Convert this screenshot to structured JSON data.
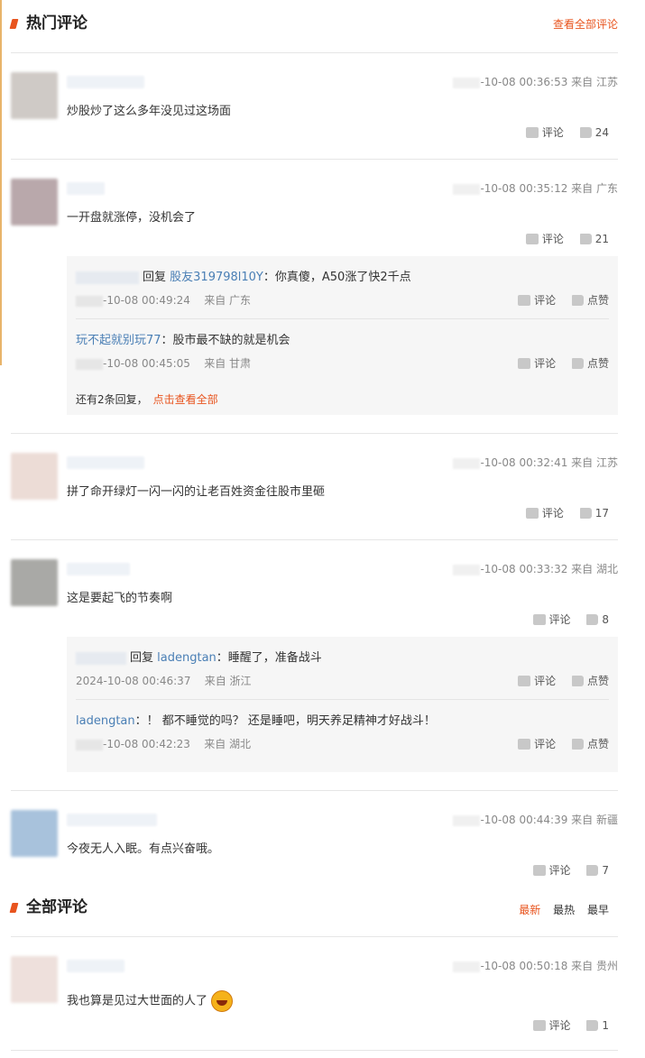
{
  "hot": {
    "title": "热门评论",
    "view_all": "查看全部评论"
  },
  "all": {
    "title": "全部评论",
    "sort": [
      "最新",
      "最热",
      "最早"
    ]
  },
  "action_labels": {
    "comment": "评论",
    "like": "点赞"
  },
  "hot_comments": [
    {
      "time": "-10-08 00:36:53 来自 江苏",
      "text": "炒股炒了这么多年没见过这场面",
      "likes": "24"
    },
    {
      "time": "-10-08 00:35:12 来自 广东",
      "text": "一开盘就涨停，没机会了",
      "likes": "21",
      "replies": [
        {
          "prefix": "回复",
          "target": "股友319798l10Y",
          "content": "：你真傻，A50涨了快2千点",
          "date": "-10-08 00:49:24",
          "loc": "来自 广东"
        },
        {
          "name": "玩不起就别玩77",
          "content": "：股市最不缺的就是机会",
          "date": "-10-08 00:45:05",
          "loc": "来自 甘肃"
        }
      ],
      "more_text": "还有2条回复，",
      "more_link": "点击查看全部"
    },
    {
      "time": "-10-08 00:32:41 来自 江苏",
      "text": "拼了命开绿灯一闪一闪的让老百姓资金往股市里砸",
      "likes": "17"
    },
    {
      "time": "-10-08 00:33:32 来自 湖北",
      "text": "这是要起飞的节奏啊",
      "likes": "8",
      "replies": [
        {
          "prefix": "回复",
          "target": "ladengtan",
          "content": "：睡醒了，准备战斗",
          "date": "2024-10-08 00:46:37",
          "loc": "来自 浙江"
        },
        {
          "name": "ladengtan",
          "content": "：！ 都不睡觉的吗？ 还是睡吧，明天养足精神才好战斗！",
          "date": "-10-08 00:42:23",
          "loc": "来自 湖北"
        }
      ]
    },
    {
      "time": "-10-08 00:44:39 来自 新疆",
      "text": "今夜无人入眠。有点兴奋哦。",
      "likes": "7"
    }
  ],
  "all_comments": [
    {
      "time": "-10-08 00:50:18 来自 贵州",
      "text": "我也算是见过大世面的人了",
      "likes": "1"
    }
  ],
  "colors": {
    "accent": "#e8541e",
    "link": "#4a7fb5"
  }
}
